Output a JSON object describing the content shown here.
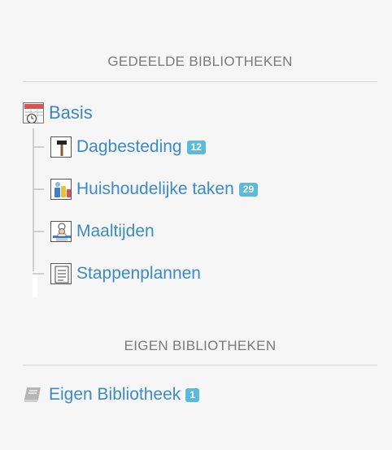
{
  "shared": {
    "title": "GEDEELDE BIBLIOTHEKEN",
    "root": {
      "label": "Basis",
      "icon": "calendar-clock-icon"
    },
    "children": [
      {
        "label": "Dagbesteding",
        "count": "12",
        "icon": "hammer-icon"
      },
      {
        "label": "Huishoudelijke taken",
        "count": "29",
        "icon": "cleaning-supplies-icon"
      },
      {
        "label": "Maaltijden",
        "count": "",
        "icon": "chef-icon"
      },
      {
        "label": "Stappenplannen",
        "count": "",
        "icon": "checklist-icon"
      }
    ]
  },
  "own": {
    "title": "EIGEN BIBLIOTHEKEN",
    "items": [
      {
        "label": "Eigen Bibliotheek",
        "count": "1",
        "icon": "book-icon"
      }
    ]
  },
  "colors": {
    "link": "#3a8bc8",
    "badge": "#5bbad9",
    "heading": "#7a7a7a"
  }
}
